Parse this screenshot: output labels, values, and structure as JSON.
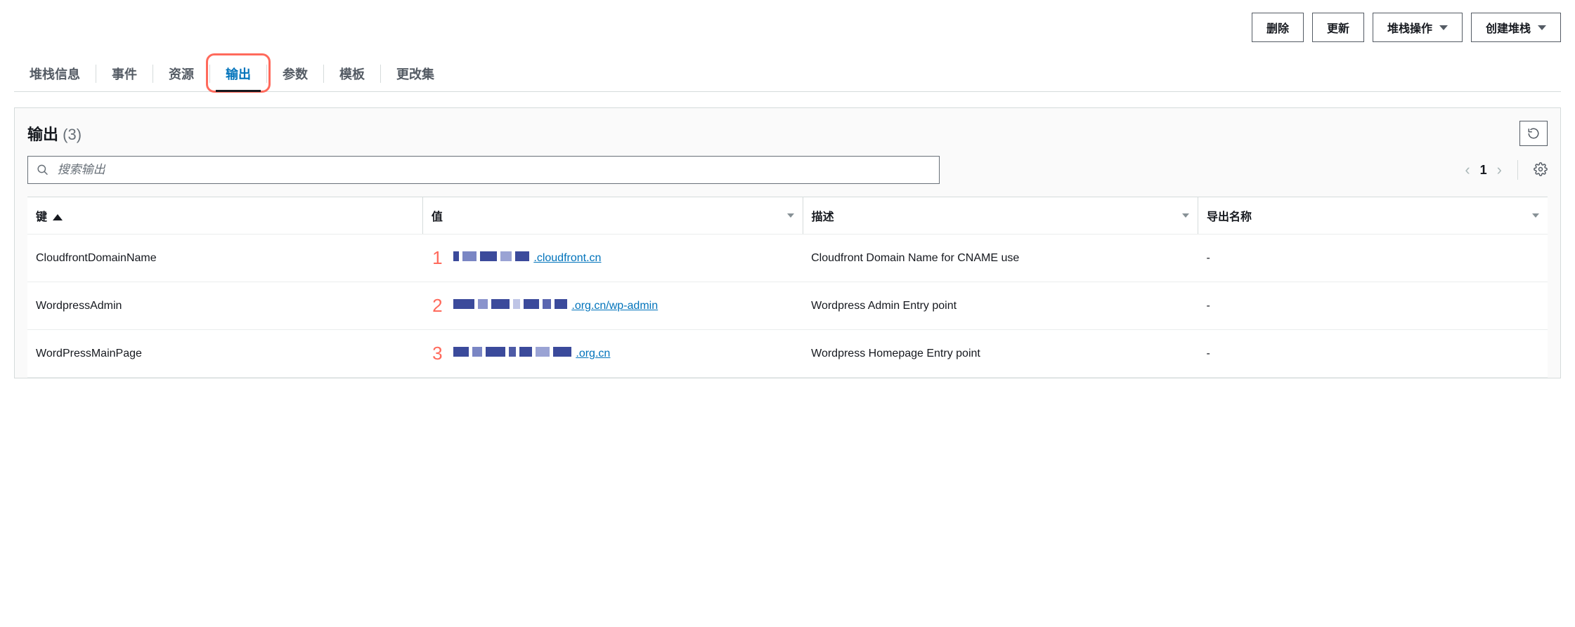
{
  "actions": {
    "delete": "删除",
    "update": "更新",
    "stack_ops": "堆栈操作",
    "create_stack": "创建堆栈"
  },
  "tabs": {
    "items": [
      {
        "label": "堆栈信息"
      },
      {
        "label": "事件"
      },
      {
        "label": "资源"
      },
      {
        "label": "输出",
        "active": true,
        "highlighted": true
      },
      {
        "label": "参数"
      },
      {
        "label": "模板"
      },
      {
        "label": "更改集"
      }
    ]
  },
  "panel": {
    "title": "输出",
    "count": "(3)",
    "search_placeholder": "搜索输出",
    "page_number": "1"
  },
  "table": {
    "headers": {
      "key": "键",
      "value": "值",
      "description": "描述",
      "export_name": "导出名称"
    },
    "rows": [
      {
        "annot": "1",
        "key": "CloudfrontDomainName",
        "value_suffix": ".cloudfront.cn",
        "description": "Cloudfront Domain Name for CNAME use",
        "export": "-"
      },
      {
        "annot": "2",
        "key": "WordpressAdmin",
        "value_suffix": ".org.cn/wp-admin",
        "description": "Wordpress Admin Entry point",
        "export": "-"
      },
      {
        "annot": "3",
        "key": "WordPressMainPage",
        "value_suffix": ".org.cn",
        "description": "Wordpress Homepage Entry point",
        "export": "-"
      }
    ]
  }
}
